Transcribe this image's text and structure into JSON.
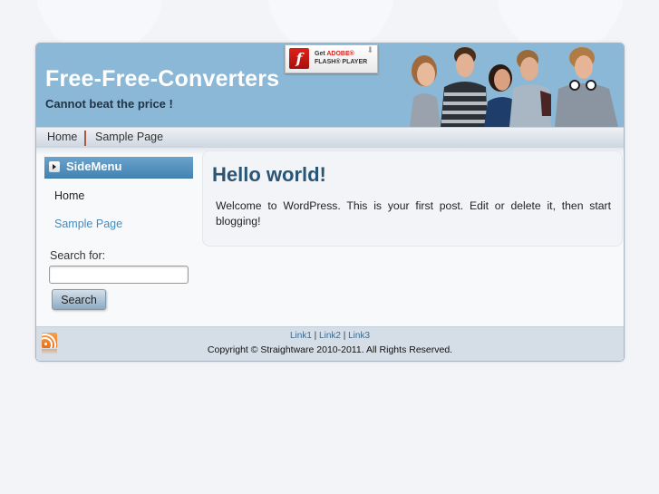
{
  "header": {
    "site_title": "Free-Free-Converters",
    "tagline": "Cannot beat the price !",
    "flash_badge": {
      "line1_prefix": "Get ",
      "line1_brand": "ADOBE®",
      "line2": "FLASH® PLAYER",
      "icon": "flash-logo-icon"
    },
    "banner_image": "group-of-five-smiling-teens"
  },
  "nav": {
    "items": [
      {
        "label": "Home"
      },
      {
        "label": "Sample Page"
      }
    ]
  },
  "sidebar": {
    "heading": "SideMenu",
    "links": [
      {
        "label": "Home",
        "color": "#222222"
      },
      {
        "label": "Sample Page",
        "color": "#4a8ab8"
      }
    ],
    "search": {
      "label": "Search for:",
      "value": "",
      "placeholder": "",
      "button_label": "Search"
    }
  },
  "post": {
    "title": "Hello world!",
    "body": "Welcome to WordPress. This is your first post. Edit or delete it, then start blogging!"
  },
  "footer": {
    "links": [
      {
        "label": "Link1"
      },
      {
        "label": "Link2"
      },
      {
        "label": "Link3"
      }
    ],
    "separator": " | ",
    "copyright": "Copyright © Straightware 2010-2011. All Rights Reserved.",
    "rss_icon": "rss-feed-icon"
  },
  "colors": {
    "header_bg": "#8bb8d6",
    "title_color": "#ffffff",
    "post_title": "#2a5573",
    "link_blue": "#4a8ab8",
    "footer_bg": "#d5dee7"
  }
}
